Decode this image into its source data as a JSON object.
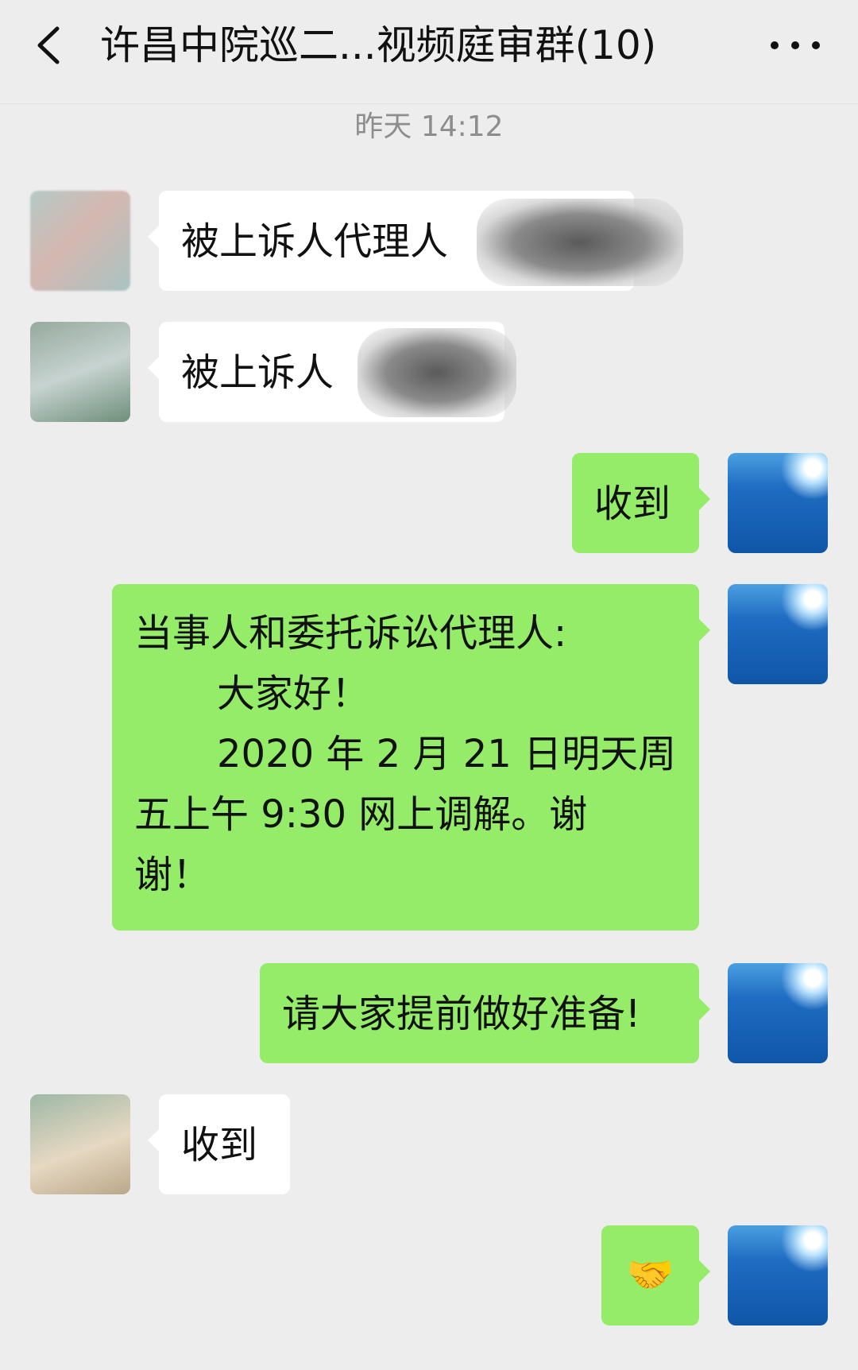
{
  "header": {
    "title": "许昌中院巡二...视频庭审群(10)",
    "back_icon": "chevron-left-icon",
    "more_icon": "more-dots-icon"
  },
  "timestamp": "昨天 14:12",
  "messages": [
    {
      "side": "left",
      "text": "被上诉人代理人"
    },
    {
      "side": "left",
      "text": "被上诉人"
    },
    {
      "side": "right",
      "text": "收到"
    },
    {
      "side": "right",
      "lines": [
        "当事人和委托诉讼代理人:",
        "大家好！",
        "2020 年 2 月 21 日明天周",
        "五上午 9:30 网上调解。谢",
        "谢！"
      ]
    },
    {
      "side": "right",
      "text": "请大家提前做好准备!"
    },
    {
      "side": "left",
      "text": "收到"
    },
    {
      "side": "right",
      "emoji": "🤝"
    }
  ],
  "colors": {
    "background": "#ededed",
    "own_bubble": "#95ec69",
    "other_bubble": "#ffffff"
  }
}
